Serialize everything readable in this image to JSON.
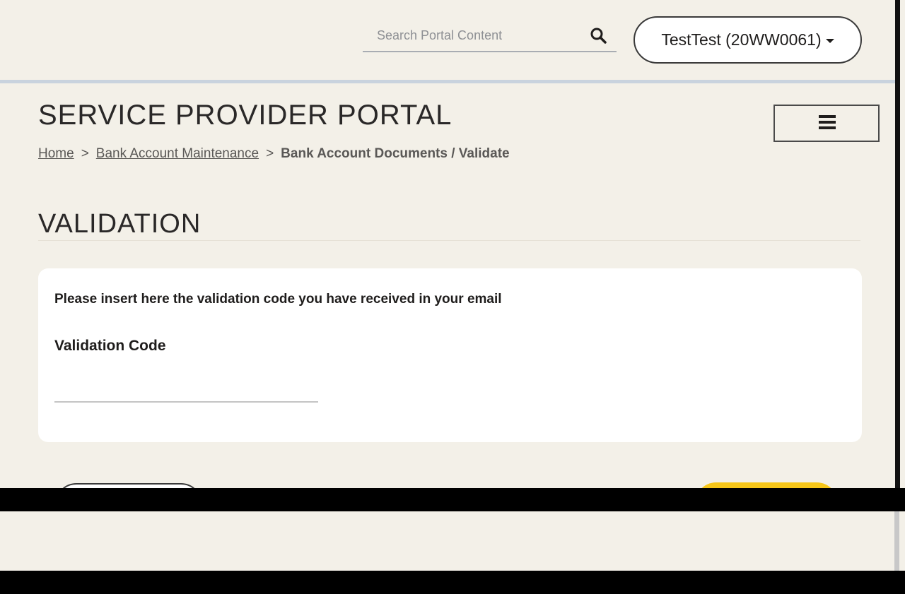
{
  "search": {
    "placeholder": "Search Portal Content",
    "icon": "search-icon"
  },
  "account": {
    "label": "TestTest (20WW0061)"
  },
  "portal": {
    "title": "SERVICE PROVIDER PORTAL",
    "menu_icon": "hamburger-menu-icon"
  },
  "breadcrumb": {
    "items": [
      {
        "label": "Home"
      },
      {
        "label": "Bank Account Maintenance"
      }
    ],
    "separator": ">",
    "current": "Bank Account Documents / Validate"
  },
  "section": {
    "title": "VALIDATION"
  },
  "form": {
    "instruction": "Please insert here the validation code you have received in your email",
    "field_label": "Validation Code",
    "field_value": ""
  },
  "colors": {
    "background": "#f3f0e8",
    "accent": "#f6c619",
    "rule": "#c9d3de"
  }
}
